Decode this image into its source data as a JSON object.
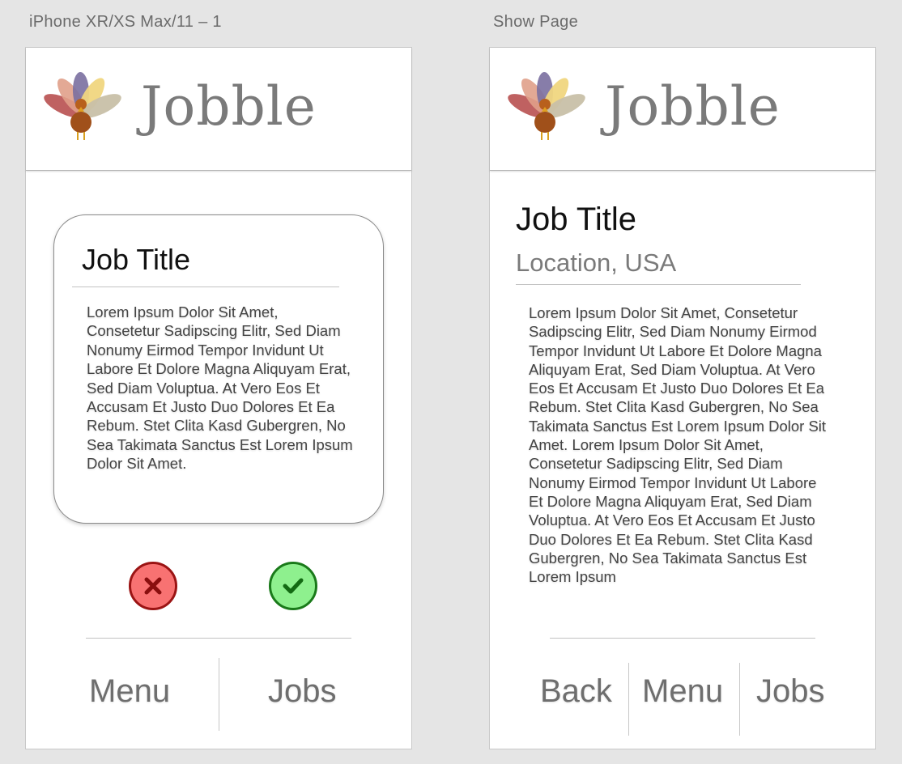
{
  "artboards": [
    {
      "label": "iPhone XR/XS Max/11 – 1"
    },
    {
      "label": "Show Page"
    }
  ],
  "brand": {
    "name": "Jobble",
    "logo_icon": "turkey-icon"
  },
  "swipe_screen": {
    "card": {
      "title": "Job Title",
      "description": "Lorem Ipsum Dolor Sit Amet, Consetetur Sadipscing Elitr, Sed Diam Nonumy Eirmod Tempor Invidunt Ut Labore Et Dolore Magna Aliquyam Erat, Sed Diam Voluptua. At Vero Eos Et Accusam Et Justo Duo Dolores Et Ea Rebum. Stet Clita Kasd Gubergren, No Sea Takimata Sanctus Est Lorem Ipsum Dolor Sit Amet."
    },
    "actions": {
      "reject_icon": "x-icon",
      "accept_icon": "checkmark-icon",
      "reject_color": "#f87272",
      "accept_color": "#8ef08e"
    },
    "nav": {
      "menu": "Menu",
      "jobs": "Jobs"
    }
  },
  "show_screen": {
    "title": "Job Title",
    "location": "Location, USA",
    "description": "Lorem Ipsum Dolor Sit Amet, Consetetur Sadipscing Elitr, Sed Diam Nonumy Eirmod Tempor Invidunt Ut Labore Et Dolore Magna Aliquyam Erat, Sed Diam Voluptua. At Vero Eos Et Accusam Et Justo Duo Dolores Et Ea Rebum. Stet Clita Kasd Gubergren, No Sea Takimata Sanctus Est Lorem Ipsum Dolor Sit Amet. Lorem Ipsum Dolor Sit Amet, Consetetur Sadipscing Elitr, Sed Diam Nonumy Eirmod Tempor Invidunt Ut Labore Et Dolore Magna Aliquyam Erat, Sed Diam Voluptua. At Vero Eos Et Accusam Et Justo Duo Dolores Et Ea Rebum. Stet Clita Kasd Gubergren, No Sea Takimata Sanctus Est Lorem Ipsum",
    "nav": {
      "back": "Back",
      "menu": "Menu",
      "jobs": "Jobs"
    }
  }
}
